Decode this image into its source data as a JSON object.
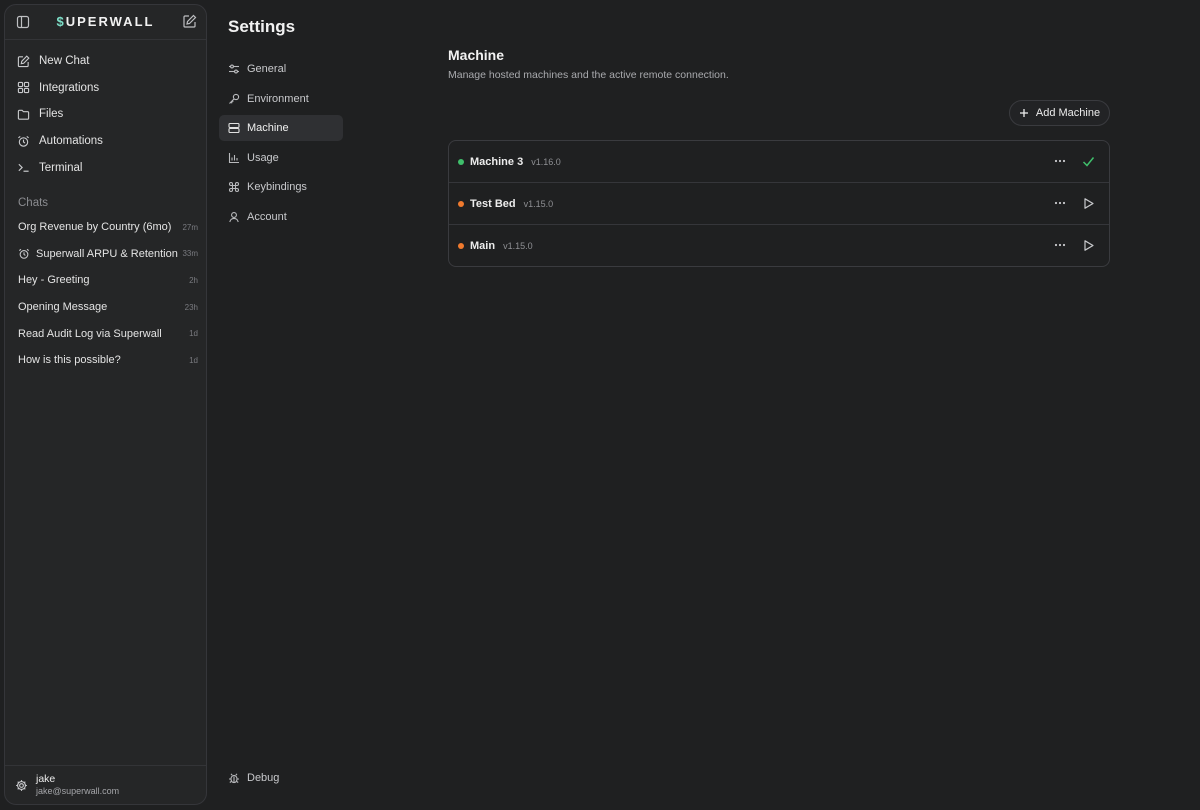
{
  "sidebar": {
    "logo": {
      "prefix": "$",
      "rest": "UPERWALL"
    },
    "nav": [
      {
        "label": "New Chat",
        "icon": "compose-icon"
      },
      {
        "label": "Integrations",
        "icon": "grid-icon"
      },
      {
        "label": "Files",
        "icon": "folder-icon"
      },
      {
        "label": "Automations",
        "icon": "alarm-icon"
      },
      {
        "label": "Terminal",
        "icon": "terminal-icon"
      }
    ],
    "chats_title": "Chats",
    "chats": [
      {
        "title": "Org Revenue by Country (6mo)",
        "time": "27m",
        "icon": ""
      },
      {
        "title": "Superwall ARPU & Retention",
        "time": "33m",
        "icon": "alarm-icon"
      },
      {
        "title": "Hey - Greeting",
        "time": "2h",
        "icon": ""
      },
      {
        "title": "Opening Message",
        "time": "23h",
        "icon": ""
      },
      {
        "title": "Read Audit Log via Superwall",
        "time": "1d",
        "icon": ""
      },
      {
        "title": "How is this possible?",
        "time": "1d",
        "icon": ""
      }
    ],
    "user": {
      "name": "jake",
      "email": "jake@superwall.com"
    }
  },
  "settings": {
    "title": "Settings",
    "nav": [
      {
        "label": "General",
        "icon": "sliders-icon"
      },
      {
        "label": "Environment",
        "icon": "key-icon"
      },
      {
        "label": "Machine",
        "icon": "server-icon",
        "active": true
      },
      {
        "label": "Usage",
        "icon": "bar-chart-icon"
      },
      {
        "label": "Keybindings",
        "icon": "command-icon"
      },
      {
        "label": "Account",
        "icon": "user-icon"
      }
    ],
    "debug_label": "Debug"
  },
  "main": {
    "title": "Machine",
    "description": "Manage hosted machines and the active remote connection.",
    "add_button": "Add Machine",
    "machines": [
      {
        "name": "Machine 3",
        "version": "v1.16.0",
        "status_color": "#3fbf6b",
        "active": true
      },
      {
        "name": "Test Bed",
        "version": "v1.15.0",
        "status_color": "#f07a2e",
        "active": false
      },
      {
        "name": "Main",
        "version": "v1.15.0",
        "status_color": "#f07a2e",
        "active": false
      }
    ]
  },
  "colors": {
    "accent": "#7ee0c9",
    "success": "#3fbf6b",
    "warning": "#f07a2e"
  }
}
